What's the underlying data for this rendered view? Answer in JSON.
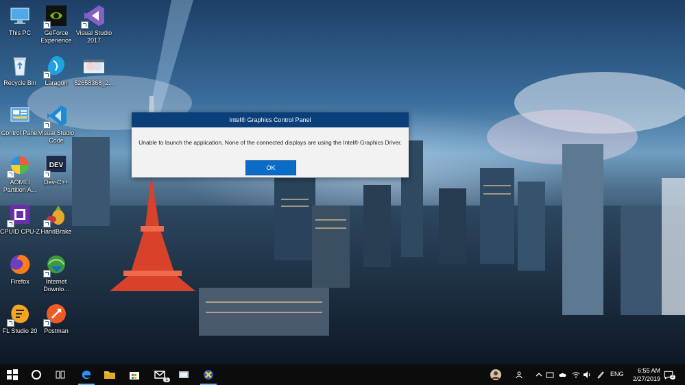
{
  "desktop": {
    "icons": [
      {
        "label": "This PC",
        "icon": "this-pc-icon"
      },
      {
        "label": "GeForce Experience",
        "icon": "geforce-experience-icon"
      },
      {
        "label": "Visual Studio 2017",
        "icon": "visual-studio-2017-icon"
      },
      {
        "label": "Recycle Bin",
        "icon": "recycle-bin-icon"
      },
      {
        "label": "Laragon",
        "icon": "laragon-icon"
      },
      {
        "label": "52658368_2...",
        "icon": "image-file-icon"
      },
      {
        "label": "Control Panel",
        "icon": "control-panel-icon"
      },
      {
        "label": "Visual Studio Code",
        "icon": "visual-studio-code-icon"
      },
      {
        "label": "AOMEI Partition A...",
        "icon": "aomei-partition-icon"
      },
      {
        "label": "Dev-C++",
        "icon": "dev-cpp-icon"
      },
      {
        "label": "CPUID CPU-Z",
        "icon": "cpu-z-icon"
      },
      {
        "label": "HandBrake",
        "icon": "handbrake-icon"
      },
      {
        "label": "Firefox",
        "icon": "firefox-icon"
      },
      {
        "label": "Internet Downlo...",
        "icon": "internet-download-manager-icon"
      },
      {
        "label": "FL Studio 20",
        "icon": "fl-studio-icon"
      },
      {
        "label": "Postman",
        "icon": "postman-icon"
      }
    ]
  },
  "dialog": {
    "title": "Intel® Graphics Control Panel",
    "message": "Unable to launch the application. None of the connected displays are using the Intel® Graphics Driver.",
    "ok_label": "OK"
  },
  "taskbar": {
    "pinned": [
      "start-icon",
      "cortana-icon",
      "task-view-icon",
      "edge-icon",
      "file-explorer-icon",
      "store-icon",
      "mail-icon",
      "app-icon",
      "xampp-icon"
    ],
    "mail_badge": "1",
    "language": "ENG",
    "time": "6:55 AM",
    "date": "2/27/2019",
    "notifications_count": "2"
  }
}
